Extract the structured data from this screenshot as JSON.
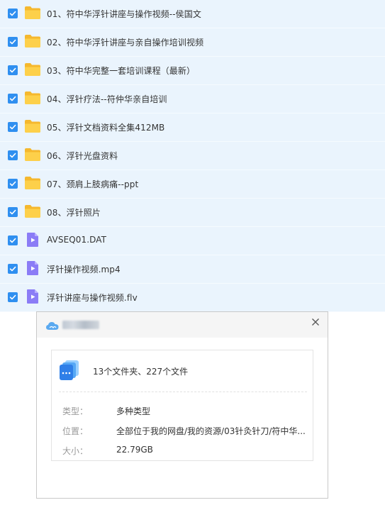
{
  "files": [
    {
      "name": "01、符中华浮针讲座与操作视频--侯国文",
      "type": "folder",
      "checked": true
    },
    {
      "name": "02、符中华浮针讲座与亲自操作培训视频",
      "type": "folder",
      "checked": true
    },
    {
      "name": "03、符中华完整一套培训课程（最新）",
      "type": "folder",
      "checked": true
    },
    {
      "name": "04、浮针疗法--符仲华亲自培训",
      "type": "folder",
      "checked": true
    },
    {
      "name": "05、浮针文档资料全集412MB",
      "type": "folder",
      "checked": true
    },
    {
      "name": "06、浮针光盘资料",
      "type": "folder",
      "checked": true
    },
    {
      "name": "07、颈肩上肢病痛--ppt",
      "type": "folder",
      "checked": true
    },
    {
      "name": "08、浮针照片",
      "type": "folder",
      "checked": true
    },
    {
      "name": "AVSEQ01.DAT",
      "type": "video",
      "checked": true
    },
    {
      "name": "浮针操作视频.mp4",
      "type": "video",
      "checked": true
    },
    {
      "name": "浮针讲座与操作视频.flv",
      "type": "video",
      "checked": true
    }
  ],
  "dialog": {
    "summary": "13个文件夹、227个文件",
    "type_label": "类型：",
    "type_value": "多种类型",
    "location_label": "位置：",
    "location_value": "全部位于我的网盘/我的资源/03针灸针刀/符中华...",
    "size_label": "大小：",
    "size_value": "22.79GB"
  },
  "colors": {
    "accent": "#2f8ff0",
    "row_bg": "#eaf4fd",
    "folder": "#fdc83a",
    "video": "#8b7cf6"
  },
  "icons": {
    "folder": "folder-icon",
    "video": "video-file-icon",
    "check": "check-icon",
    "close": "close-icon"
  }
}
